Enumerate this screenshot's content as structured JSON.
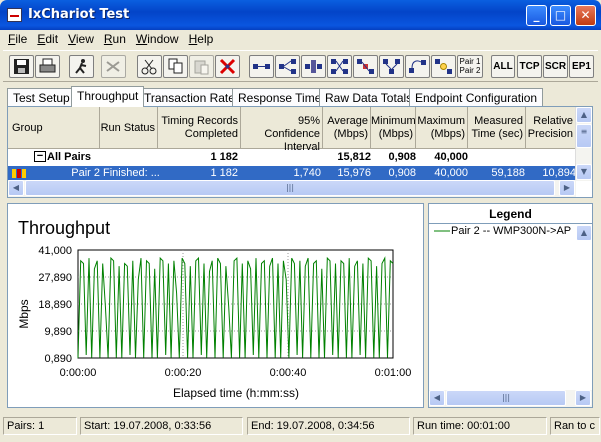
{
  "window": {
    "title": "IxChariot Test"
  },
  "menu": [
    "File",
    "Edit",
    "View",
    "Run",
    "Window",
    "Help"
  ],
  "toolbar": {
    "pair_label_1": "Pair 1",
    "pair_label_2": "Pair 2",
    "filters": [
      "ALL",
      "TCP",
      "SCR",
      "EP1"
    ]
  },
  "tabs": [
    "Test Setup",
    "Throughput",
    "Transaction Rate",
    "Response Time",
    "Raw Data Totals",
    "Endpoint Configuration"
  ],
  "active_tab": "Throughput",
  "grid": {
    "headers": [
      {
        "line1": "",
        "line2": "Group"
      },
      {
        "line1": "",
        "line2": "Run Status"
      },
      {
        "line1": "Timing Records",
        "line2": "Completed"
      },
      {
        "line1": "95% Confidence",
        "line2": "Interval"
      },
      {
        "line1": "Average",
        "line2": "(Mbps)"
      },
      {
        "line1": "Minimum",
        "line2": "(Mbps)"
      },
      {
        "line1": "Maximum",
        "line2": "(Mbps)"
      },
      {
        "line1": "Measured",
        "line2": "Time (sec)"
      },
      {
        "line1": "Relative",
        "line2": "Precision"
      }
    ],
    "group_row": {
      "expander": "−",
      "name": "All Pairs",
      "records": "1 182",
      "average": "15,812",
      "minimum": "0,908",
      "maximum": "40,000"
    },
    "pair_row": {
      "name": "Pair 2",
      "status": "Finished: ...",
      "records": "1 182",
      "interval": "1,740",
      "average": "15,976",
      "minimum": "0,908",
      "maximum": "40,000",
      "time": "59,188",
      "precision": "10,894"
    }
  },
  "chart": {
    "title": "Throughput",
    "ylabel": "Mbps",
    "xlabel": "Elapsed time (h:mm:ss)",
    "line_color": "#008000"
  },
  "chart_data": {
    "type": "line",
    "title": "Throughput",
    "xlabel": "Elapsed time (h:mm:ss)",
    "ylabel": "Mbps",
    "ylim": [
      0.89,
      41.0
    ],
    "xlim": [
      "0:00:00",
      "0:01:00"
    ],
    "x_ticks": [
      "0:00:00",
      "0:00:20",
      "0:00:40",
      "0:01:00"
    ],
    "y_ticks": [
      "41,000",
      "27,890",
      "18,890",
      "9,890",
      "0,890"
    ],
    "grid": true,
    "series": [
      {
        "name": "Pair 2 -- WMP300N->AP",
        "x_range_sec": [
          0,
          60
        ],
        "values_mbps": [
          0.9,
          37,
          36,
          2,
          38,
          1,
          34,
          37,
          1,
          36,
          20,
          1,
          38,
          37,
          1,
          35,
          1,
          36,
          35,
          2,
          37,
          1,
          30,
          38,
          1,
          37,
          36,
          1,
          34,
          1,
          38,
          37,
          2,
          36,
          1,
          37,
          25,
          1,
          38,
          36,
          1,
          35,
          1,
          37,
          38,
          2,
          36,
          1,
          33,
          37,
          1,
          38,
          36,
          1,
          35,
          20,
          1,
          37,
          38,
          1,
          36,
          1,
          37,
          34,
          2,
          38,
          1,
          36,
          37,
          1,
          35,
          38,
          1,
          36,
          1,
          37,
          30,
          1,
          38,
          36,
          2,
          37,
          1,
          35,
          38,
          1,
          36,
          37,
          1,
          34,
          1,
          38,
          37,
          2,
          36,
          1,
          37,
          36,
          1,
          38,
          1,
          35,
          37,
          2,
          36,
          1,
          38,
          37,
          1,
          35,
          1,
          36,
          38,
          1,
          37,
          36
        ]
      }
    ]
  },
  "legend": {
    "title": "Legend",
    "entries": [
      "Pair 2 -- WMP300N->AP"
    ]
  },
  "status": {
    "pairs": "Pairs: 1",
    "start": "Start: 19.07.2008, 0:33:56",
    "end": "End: 19.07.2008, 0:34:56",
    "run_time": "Run time: 00:01:00",
    "ran": "Ran to c"
  }
}
